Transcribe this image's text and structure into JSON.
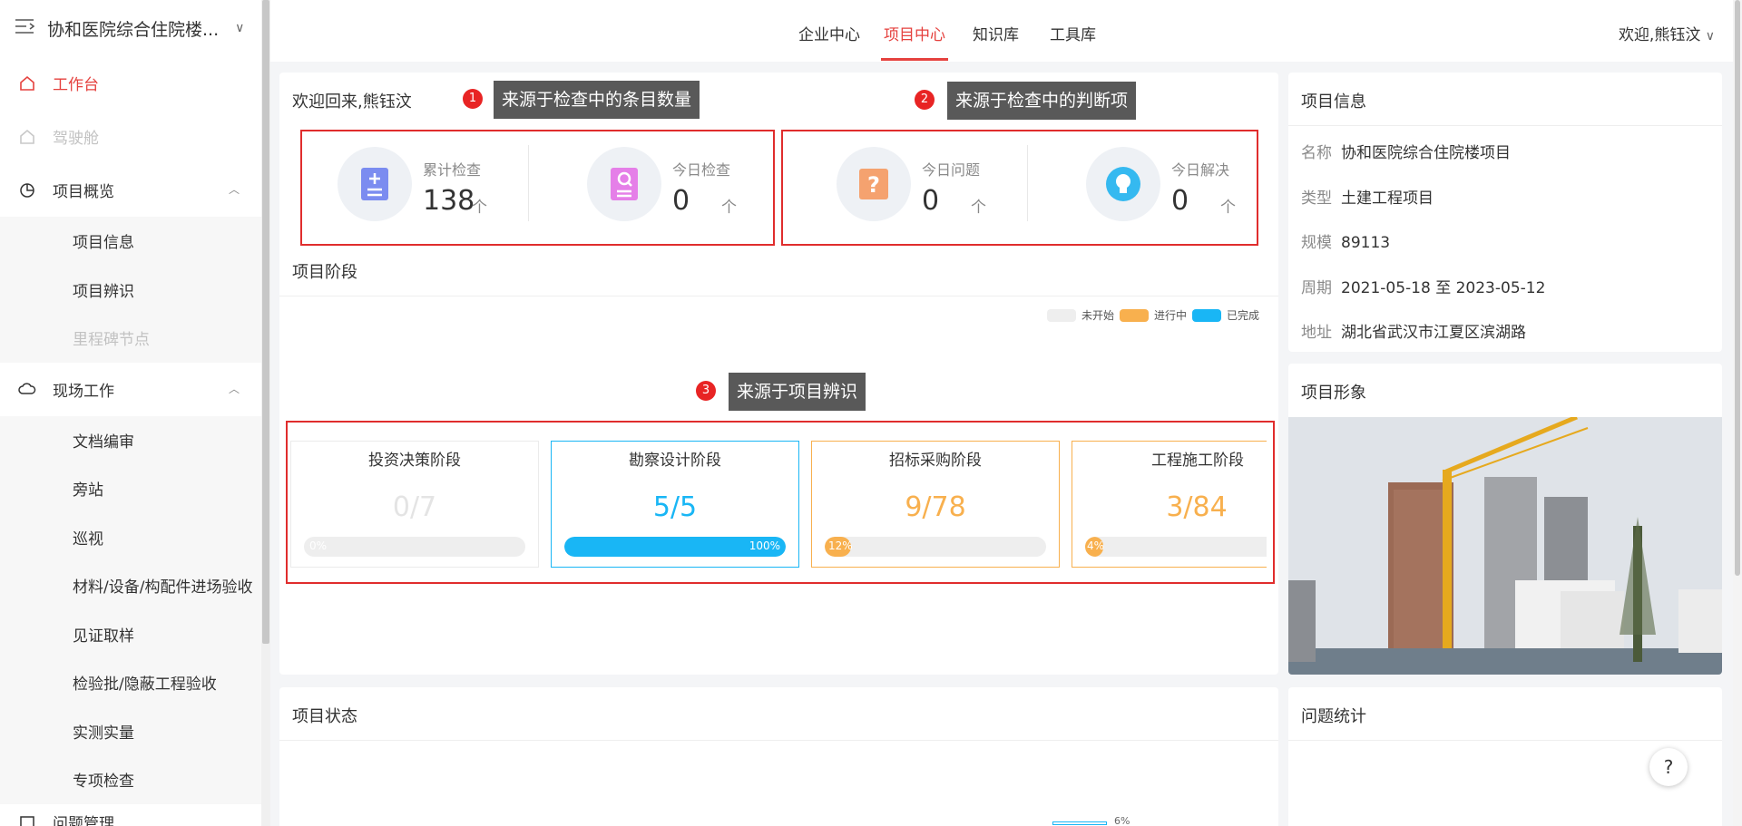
{
  "sidebar": {
    "title": "协和医院综合住院楼...",
    "items": [
      {
        "label": "工作台"
      },
      {
        "label": "驾驶舱"
      },
      {
        "label": "项目概览"
      },
      {
        "label": "现场工作"
      },
      {
        "label": "问题管理"
      }
    ],
    "overview_sub": [
      "项目信息",
      "项目辨识",
      "里程碑节点"
    ],
    "field_sub": [
      "文档编审",
      "旁站",
      "巡视",
      "材料/设备/构配件进场验收",
      "见证取样",
      "检验批/隐蔽工程验收",
      "实测实量",
      "专项检查"
    ]
  },
  "topnav": {
    "tabs": [
      "企业中心",
      "项目中心",
      "知识库",
      "工具库"
    ],
    "active_tab": "项目中心",
    "welcome": "欢迎,熊钰汶"
  },
  "dashboard": {
    "greeting": "欢迎回来,熊钰汶",
    "stats": [
      {
        "label": "累计检查",
        "value": "138",
        "arrow": "个",
        "icon": "document-plus-icon",
        "color": "#7b8cf0"
      },
      {
        "label": "今日检查",
        "value": "0",
        "arrow": "个",
        "icon": "document-search-icon",
        "color": "#e57fe8"
      },
      {
        "label": "今日问题",
        "value": "0",
        "arrow": "个",
        "icon": "question-icon",
        "color": "#f5a26f"
      },
      {
        "label": "今日解决",
        "value": "0",
        "arrow": "个",
        "icon": "lightbulb-icon",
        "color": "#35b9f0"
      }
    ],
    "annotations": [
      {
        "num": "1",
        "text": "来源于检查中的条目数量"
      },
      {
        "num": "2",
        "text": "来源于检查中的判断项"
      },
      {
        "num": "3",
        "text": "来源于项目辨识"
      }
    ]
  },
  "stages": {
    "title": "项目阶段",
    "legend": [
      {
        "label": "未开始",
        "color": "#eeeeee"
      },
      {
        "label": "进行中",
        "color": "#f8b04e"
      },
      {
        "label": "已完成",
        "color": "#19b6f5"
      }
    ],
    "items": [
      {
        "name": "投资决策阶段",
        "value": "0/7",
        "percent": 0,
        "pct_label": "0%",
        "color": "#e8e8e8",
        "status": "未开始"
      },
      {
        "name": "勘察设计阶段",
        "value": "5/5",
        "percent": 100,
        "pct_label": "100%",
        "color": "#19b6f5",
        "status": "已完成"
      },
      {
        "name": "招标采购阶段",
        "value": "9/78",
        "percent": 12,
        "pct_label": "12%",
        "color": "#f8b04e",
        "status": "进行中"
      },
      {
        "name": "工程施工阶段",
        "value": "3/84",
        "percent": 4,
        "pct_label": "4%",
        "color": "#f8b04e",
        "status": "进行中"
      }
    ]
  },
  "project_info": {
    "title": "项目信息",
    "rows": [
      {
        "k": "名称",
        "v": "协和医院综合住院楼项目"
      },
      {
        "k": "类型",
        "v": "土建工程项目"
      },
      {
        "k": "规模",
        "v": "89113"
      },
      {
        "k": "周期",
        "v": "2021-05-18 至 2023-05-12"
      },
      {
        "k": "地址",
        "v": "湖北省武汉市江夏区滨湖路"
      }
    ]
  },
  "project_image": {
    "title": "项目形象"
  },
  "project_status": {
    "title": "项目状态",
    "peek_label": "6%"
  },
  "problem_stats": {
    "title": "问题统计"
  },
  "help": {
    "label": "?"
  }
}
